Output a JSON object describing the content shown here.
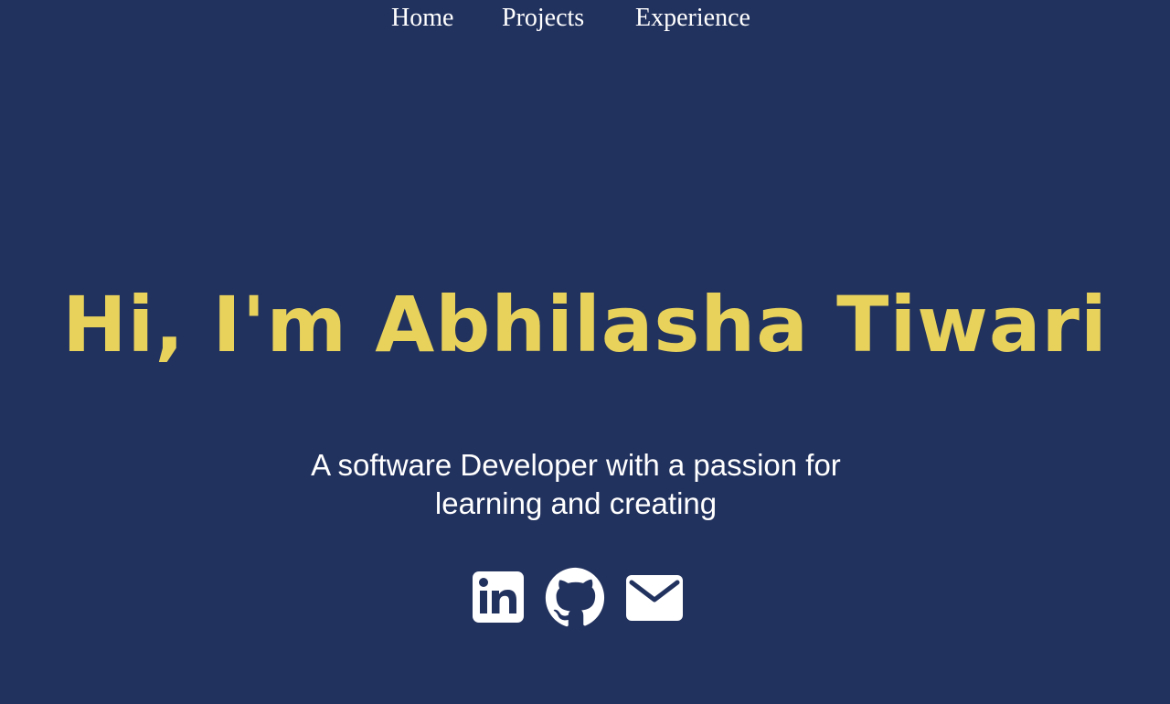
{
  "nav": {
    "items": [
      {
        "label": "Home"
      },
      {
        "label": "Projects"
      },
      {
        "label": "Experience"
      }
    ]
  },
  "hero": {
    "title": "Hi, I'm Abhilasha Tiwari",
    "subtitle": "A software Developer with a passion for learning and creating"
  },
  "social": {
    "icons": [
      "linkedin-icon",
      "github-icon",
      "mail-icon"
    ]
  },
  "colors": {
    "background": "#22325e",
    "accent": "#e8d25c",
    "text": "#ffffff"
  }
}
